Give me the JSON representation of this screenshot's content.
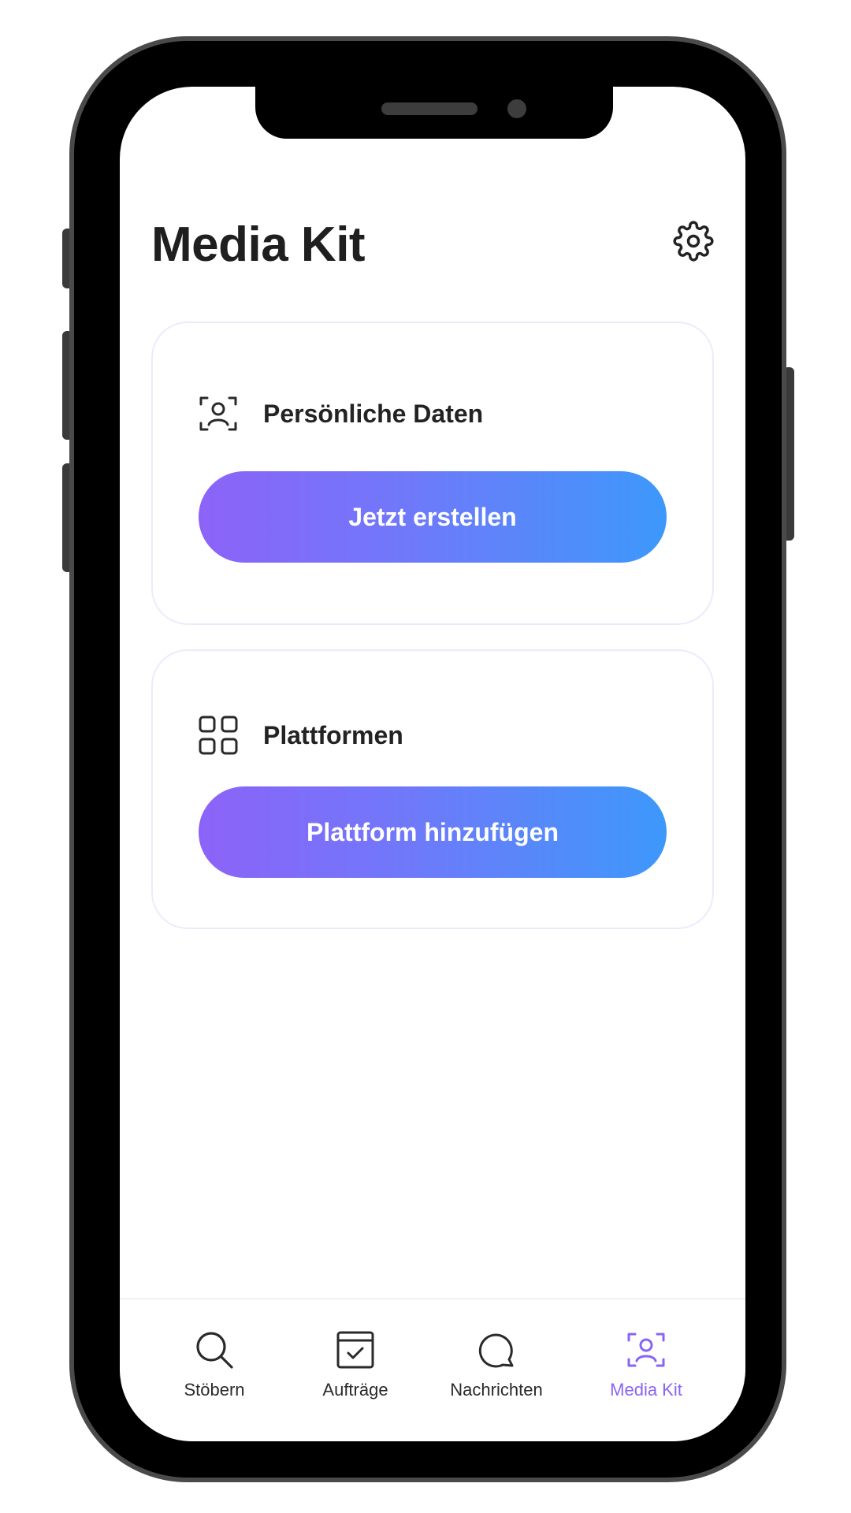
{
  "header": {
    "title": "Media Kit",
    "settings_icon": "gear-icon"
  },
  "cards": {
    "personal": {
      "icon": "user-scan-icon",
      "title": "Persönliche Daten",
      "button_label": "Jetzt erstellen"
    },
    "platforms": {
      "icon": "grid-icon",
      "title": "Plattformen",
      "button_label": "Plattform hinzufügen"
    }
  },
  "tabbar": {
    "tabs": [
      {
        "label": "Stöbern",
        "icon": "search-icon",
        "active": false
      },
      {
        "label": "Aufträge",
        "icon": "calendar-check-icon",
        "active": false
      },
      {
        "label": "Nachrichten",
        "icon": "chat-bubble-icon",
        "active": false
      },
      {
        "label": "Media Kit",
        "icon": "user-scan-icon",
        "active": true
      }
    ]
  },
  "colors": {
    "accent": "#8a63f7",
    "gradient_start": "#8c63f8",
    "gradient_end": "#3d98fb",
    "text": "#1f1f1f",
    "card_border": "#ecebfb"
  }
}
